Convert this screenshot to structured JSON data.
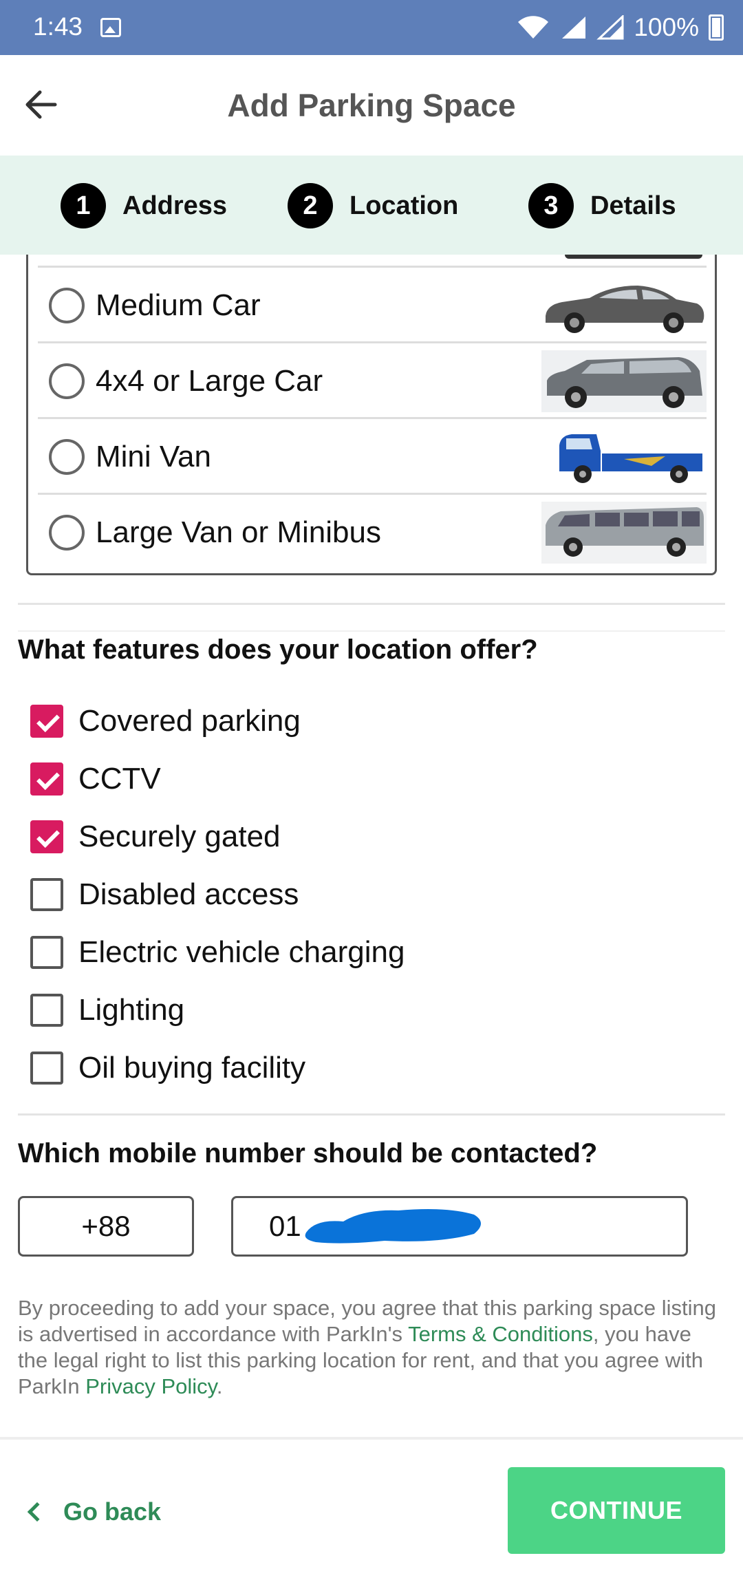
{
  "status_bar": {
    "time": "1:43",
    "battery_text": "100%"
  },
  "header": {
    "title": "Add Parking Space"
  },
  "stepper": {
    "steps": [
      {
        "num": "1",
        "label": "Address"
      },
      {
        "num": "2",
        "label": "Location"
      },
      {
        "num": "3",
        "label": "Details"
      }
    ]
  },
  "vehicles": {
    "items": [
      {
        "label": "Medium Car",
        "selected": false,
        "icon": "car-sedan-icon"
      },
      {
        "label": "4x4 or Large Car",
        "selected": false,
        "icon": "car-suv-icon"
      },
      {
        "label": "Mini Van",
        "selected": false,
        "icon": "pickup-truck-icon"
      },
      {
        "label": "Large Van or Minibus",
        "selected": false,
        "icon": "minibus-icon"
      }
    ]
  },
  "features": {
    "title": "What features does your location offer?",
    "items": [
      {
        "label": "Covered parking",
        "checked": true
      },
      {
        "label": "CCTV",
        "checked": true
      },
      {
        "label": "Securely gated",
        "checked": true
      },
      {
        "label": "Disabled access",
        "checked": false
      },
      {
        "label": "Electric vehicle charging",
        "checked": false
      },
      {
        "label": "Lighting",
        "checked": false
      },
      {
        "label": "Oil buying facility",
        "checked": false
      }
    ]
  },
  "contact": {
    "title": "Which mobile number should be contacted?",
    "country_code": "+88",
    "phone_value": "01"
  },
  "terms": {
    "text_1": "By proceeding to add your space, you agree that this parking space listing is advertised in accordance with ParkIn's ",
    "link_terms": "Terms & Conditions",
    "text_2": ", you have the legal right to list this parking location for rent, and that you agree with ParkIn ",
    "link_privacy": "Privacy Policy",
    "text_3": "."
  },
  "footer": {
    "go_back_label": "Go back",
    "continue_label": "CONTINUE"
  },
  "colors": {
    "accent": "#2e8b57",
    "checkbox": "#d81b60",
    "continue": "#4cd486",
    "status_bar": "#5e7fb9"
  }
}
